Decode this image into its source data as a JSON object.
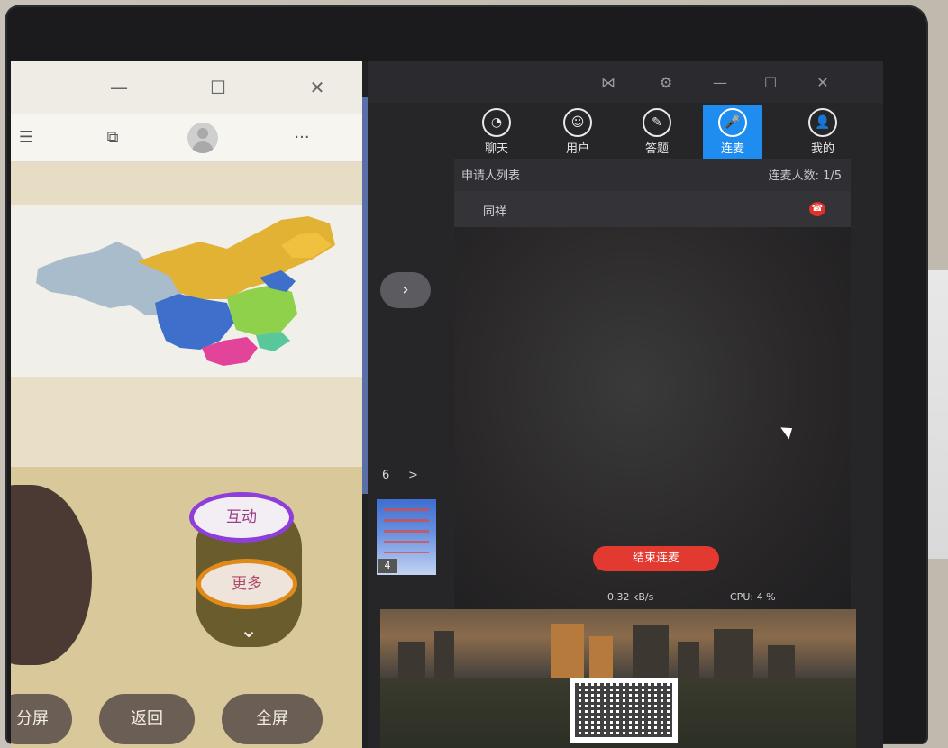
{
  "browser": {
    "window_controls": {
      "minimize": "—",
      "maximize": "☐",
      "close": "✕"
    },
    "toolbar": {
      "reading_icon": "☰",
      "collections_icon": "⧉",
      "more": "···"
    },
    "page": {
      "interact_button": "互动",
      "more_button": "更多",
      "collapse_icon": "⌄",
      "bottom_buttons": [
        "分屏",
        "返回",
        "全屏"
      ]
    }
  },
  "app": {
    "titlebar": {
      "share_icon": "⋈",
      "settings_icon": "⚙",
      "minimize": "—",
      "maximize": "☐",
      "close": "✕"
    },
    "nav_tabs": [
      {
        "label": "聊天",
        "icon": "chat-icon",
        "glyph": "◔",
        "active": false
      },
      {
        "label": "用户",
        "icon": "users-icon",
        "glyph": "☺",
        "active": false
      },
      {
        "label": "答题",
        "icon": "pen-icon",
        "glyph": "✎",
        "active": false
      },
      {
        "label": "连麦",
        "icon": "microphone-icon",
        "glyph": "🎤",
        "active": true
      },
      {
        "label": "我的",
        "icon": "profile-icon",
        "glyph": "👤",
        "active": false
      }
    ],
    "applicants": {
      "title": "申请人列表",
      "count_label": "连麦人数: 1/5",
      "rows": [
        {
          "name": "同祥"
        }
      ]
    },
    "slides": {
      "next_arrow": "›",
      "page_number": "6",
      "page_arrow": ">",
      "thumbnail_number": "4"
    },
    "end_connect_label": "结束连麦",
    "stats": {
      "net_speed": "0.32 kB/s",
      "cpu": "CPU: 4 %"
    },
    "accent_color": "#1f8cf0",
    "danger_color": "#e23a30"
  }
}
